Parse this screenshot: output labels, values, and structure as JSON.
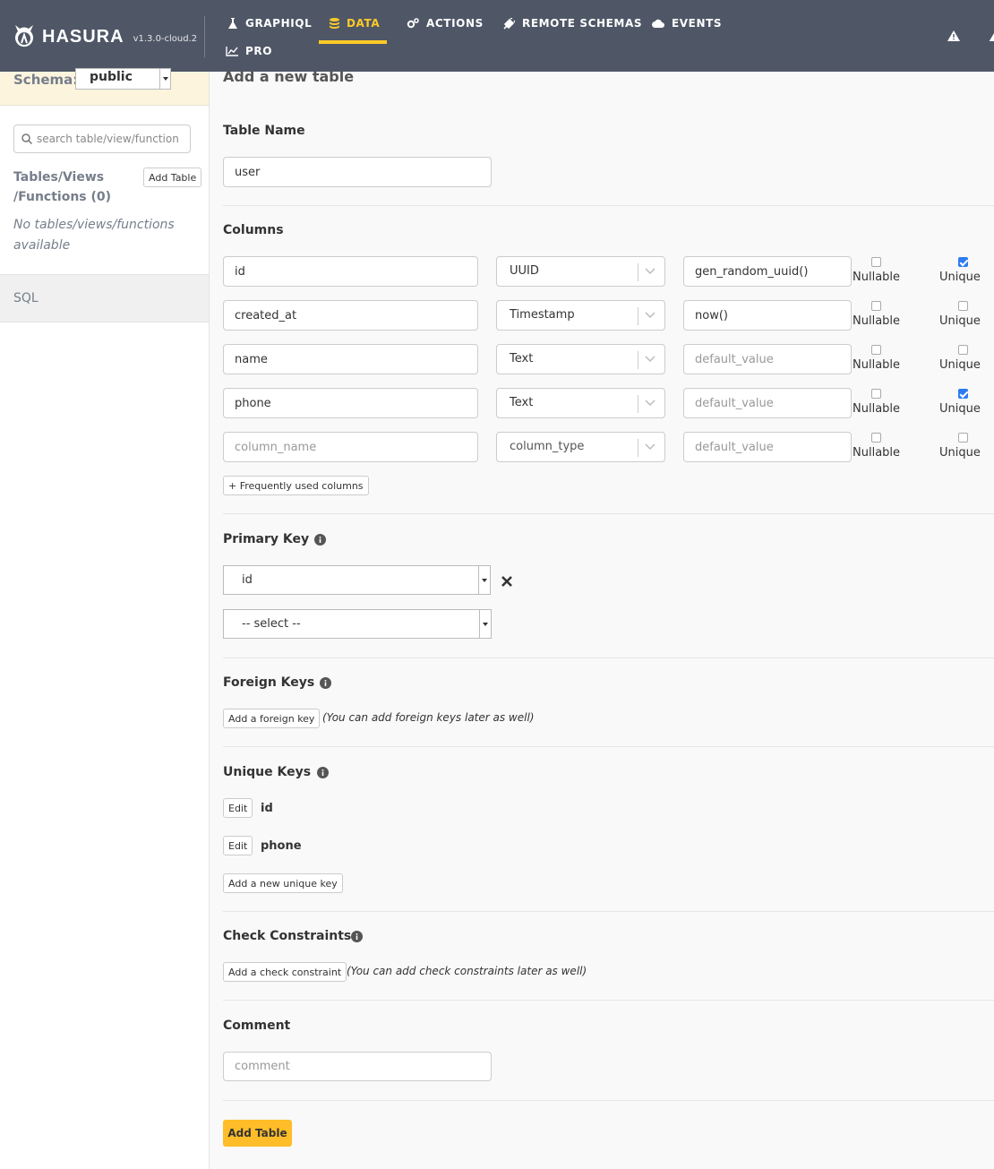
{
  "header": {
    "brand": "HASURA",
    "version": "v1.3.0-cloud.2",
    "nav": [
      {
        "label": "GRAPHIQL",
        "icon": "flask-icon"
      },
      {
        "label": "DATA",
        "icon": "database-icon",
        "active": true
      },
      {
        "label": "ACTIONS",
        "icon": "cogs-icon"
      },
      {
        "label": "REMOTE SCHEMAS",
        "icon": "plug-icon"
      },
      {
        "label": "EVENTS",
        "icon": "cloud-icon"
      },
      {
        "label": "PRO",
        "icon": "line-chart-icon"
      }
    ],
    "accent_color": "#ffca27",
    "background_color": "#4f5767"
  },
  "sidebar": {
    "schema_label": "Schema:",
    "schema_value": "public",
    "search_placeholder": "search table/view/function",
    "tables_heading": "Tables/Views /Functions (0)",
    "add_table_label": "Add Table",
    "empty_message": "No tables/views/functions available",
    "sql_label": "SQL"
  },
  "main": {
    "title": "Add a new table",
    "table_name": {
      "label": "Table Name",
      "value": "user"
    },
    "columns": {
      "label": "Columns",
      "nullable_label": "Nullable",
      "unique_label": "Unique",
      "name_placeholder": "column_name",
      "type_placeholder": "column_type",
      "default_placeholder": "default_value",
      "rows": [
        {
          "name": "id",
          "type": "UUID",
          "default": "gen_random_uuid()",
          "nullable": false,
          "unique": true
        },
        {
          "name": "created_at",
          "type": "Timestamp",
          "default": "now()",
          "nullable": false,
          "unique": false
        },
        {
          "name": "name",
          "type": "Text",
          "default": "",
          "nullable": false,
          "unique": false
        },
        {
          "name": "phone",
          "type": "Text",
          "default": "",
          "nullable": false,
          "unique": true
        },
        {
          "name": "",
          "type": "",
          "default": "",
          "nullable": false,
          "unique": false
        }
      ],
      "frequent_label": "+ Frequently used columns"
    },
    "primary_key": {
      "label": "Primary Key",
      "selected": "id",
      "placeholder": "-- select --"
    },
    "foreign_keys": {
      "label": "Foreign Keys",
      "button": "Add a foreign key",
      "note": "(You can add foreign keys later as well)"
    },
    "unique_keys": {
      "label": "Unique Keys",
      "edit_label": "Edit",
      "keys": [
        "id",
        "phone"
      ],
      "add_button": "Add a new unique key"
    },
    "check_constraints": {
      "label": "Check Constraints",
      "button": "Add a check constraint",
      "note": "(You can add check constraints later as well)"
    },
    "comment": {
      "label": "Comment",
      "placeholder": "comment"
    },
    "submit_label": "Add Table",
    "submit_color": "#febd29",
    "checkbox_color": "#2d7bf4"
  }
}
